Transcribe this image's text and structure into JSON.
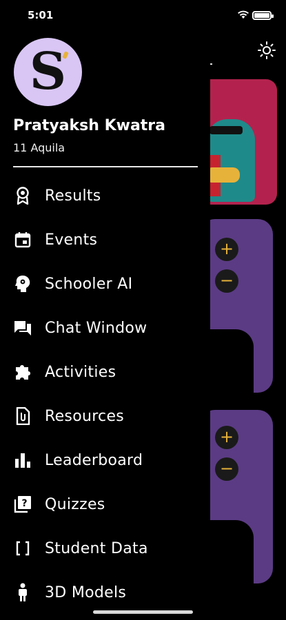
{
  "status": {
    "time": "5:01"
  },
  "profile": {
    "avatar_letter": "S",
    "name": "Pratyaksh Kwatra",
    "class": "11 Aquila"
  },
  "menu": [
    {
      "label": "Results",
      "icon": "award-icon"
    },
    {
      "label": "Events",
      "icon": "calendar-icon"
    },
    {
      "label": "Schooler AI",
      "icon": "brain-head-icon"
    },
    {
      "label": "Chat Window",
      "icon": "chat-icon"
    },
    {
      "label": "Activities",
      "icon": "puzzle-icon"
    },
    {
      "label": "Resources",
      "icon": "attachment-file-icon"
    },
    {
      "label": "Leaderboard",
      "icon": "bar-chart-icon"
    },
    {
      "label": "Quizzes",
      "icon": "quiz-icon"
    },
    {
      "label": "Student Data",
      "icon": "brackets-icon"
    },
    {
      "label": "3D Models",
      "icon": "person-icon"
    }
  ],
  "background": {
    "plus": "+",
    "minus": "−"
  },
  "colors": {
    "drawer_bg": "#000000",
    "avatar_bg": "#d9c6f5",
    "card_pink": "#b3224e",
    "card_purple": "#5b3b84",
    "accent": "#e7b23a"
  }
}
